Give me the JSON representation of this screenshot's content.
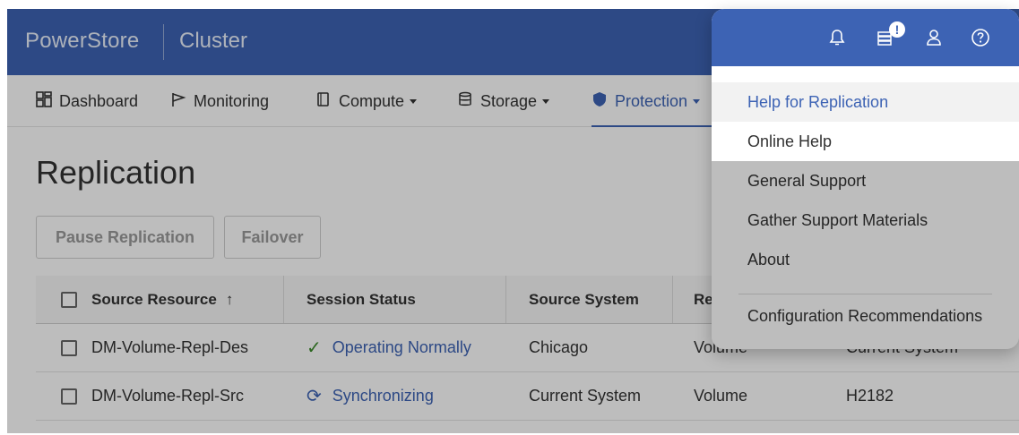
{
  "header": {
    "brand": "PowerStore",
    "cluster": "Cluster"
  },
  "nav": {
    "items": [
      {
        "label": "Dashboard",
        "icon": "dashboard-icon"
      },
      {
        "label": "Monitoring",
        "icon": "flag-icon"
      },
      {
        "label": "Compute",
        "icon": "copy-icon",
        "has_menu": true
      },
      {
        "label": "Storage",
        "icon": "database-icon",
        "has_menu": true
      },
      {
        "label": "Protection",
        "icon": "shield-icon",
        "has_menu": true,
        "active": true
      }
    ]
  },
  "page": {
    "title": "Replication",
    "actions": {
      "pause": "Pause Replication",
      "failover": "Failover"
    }
  },
  "table": {
    "columns": [
      "Source Resource",
      "Session Status",
      "Source System",
      "Res",
      ""
    ],
    "sort_indicator": "↑",
    "rows": [
      {
        "source_resource": "DM-Volume-Repl-Des",
        "session_status": "Operating Normally",
        "status_kind": "ok",
        "source_system": "Chicago",
        "resource_type": "Volume",
        "destination": "Current System"
      },
      {
        "source_resource": "DM-Volume-Repl-Src",
        "session_status": "Synchronizing",
        "status_kind": "sync",
        "source_system": "Current System",
        "resource_type": "Volume",
        "destination": "H2182"
      }
    ]
  },
  "help_menu": {
    "items": [
      {
        "label": "Help for Replication",
        "highlighted": true
      },
      {
        "label": "Online Help"
      },
      {
        "label": "General Support"
      },
      {
        "label": "Gather Support Materials"
      },
      {
        "label": "About"
      }
    ],
    "after_divider": [
      {
        "label": "Configuration Recommendations"
      }
    ],
    "header_icons": [
      "bell-icon",
      "jobs-icon",
      "user-icon",
      "help-icon"
    ],
    "jobs_badge": "!"
  },
  "colors": {
    "brand_blue": "#3d63b4",
    "success_green": "#3a8a2a"
  }
}
